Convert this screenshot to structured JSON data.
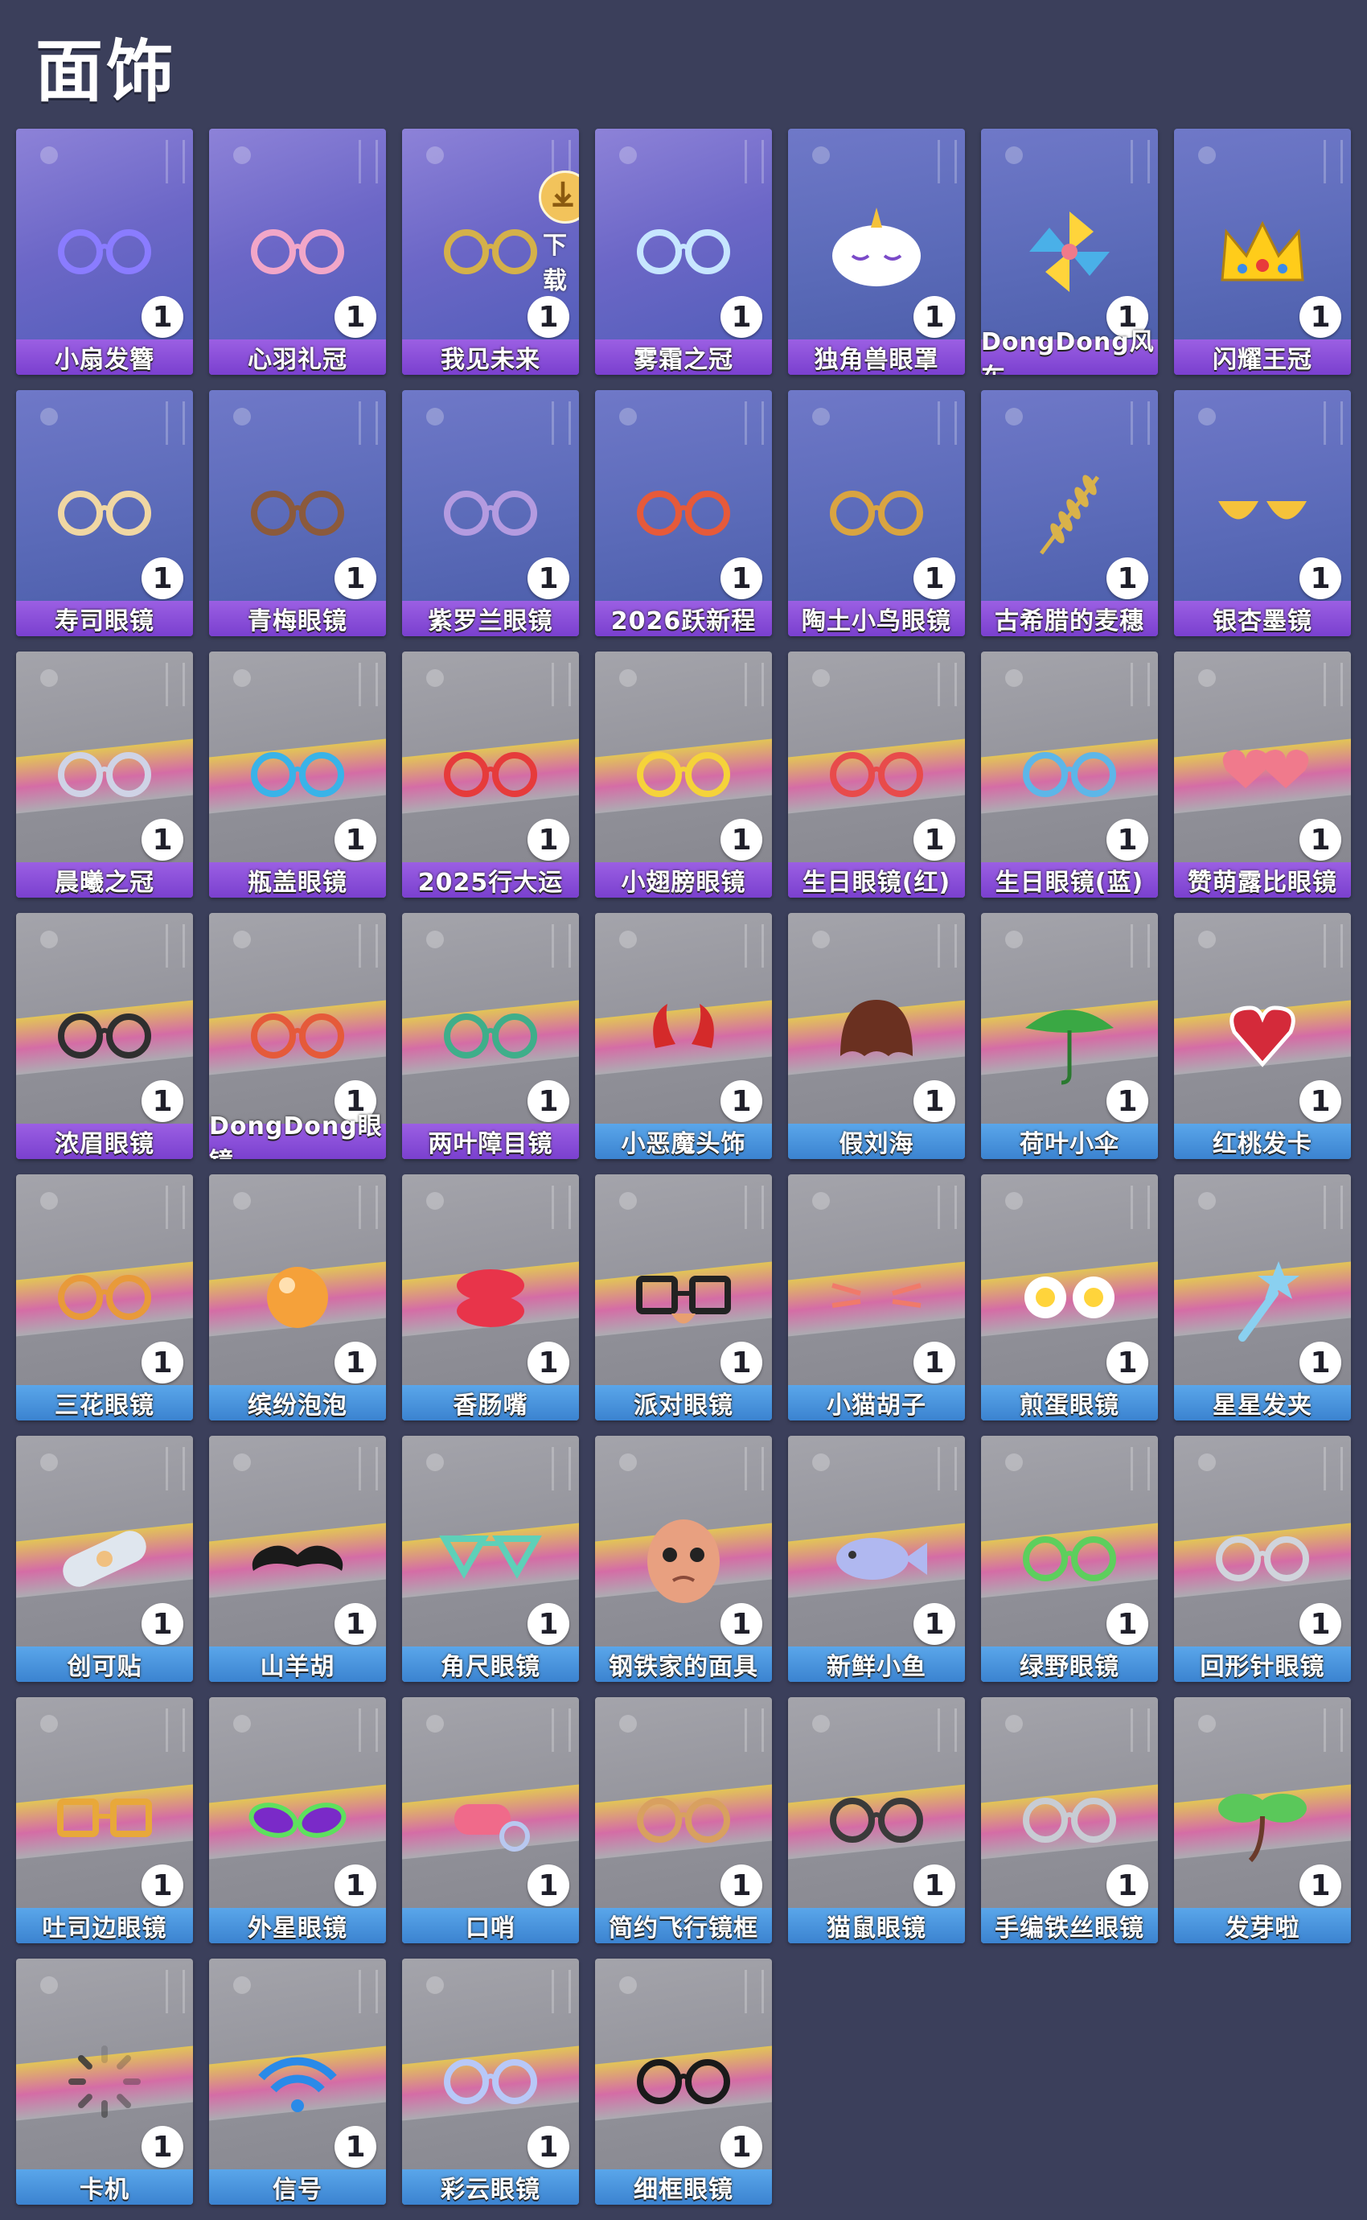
{
  "page": {
    "title": "面饰"
  },
  "download_text": "下载",
  "items": [
    {
      "name": "小扇发簪",
      "qty": "1",
      "rarity": "purple",
      "icon": "fan-hairpin-icon",
      "color": "#8a7cff"
    },
    {
      "name": "心羽礼冠",
      "qty": "1",
      "rarity": "purple",
      "icon": "feather-crown-icon",
      "color": "#f2a6c8"
    },
    {
      "name": "我见未来",
      "qty": "1",
      "rarity": "purple",
      "icon": "future-glasses-icon",
      "color": "#d4b14a"
    },
    {
      "name": "雾霜之冠",
      "qty": "1",
      "rarity": "purple",
      "icon": "frost-crown-icon",
      "color": "#c7e6ff"
    },
    {
      "name": "独角兽眼罩",
      "qty": "1",
      "rarity": "purple",
      "icon": "unicorn-mask-icon",
      "color": "#ffffff"
    },
    {
      "name": "DongDong风车",
      "qty": "1",
      "rarity": "purple",
      "icon": "pinwheel-icon",
      "color": "#ffd43b"
    },
    {
      "name": "闪耀王冠",
      "qty": "1",
      "rarity": "purple",
      "icon": "crown-icon",
      "color": "#ffcc1a"
    },
    {
      "name": "寿司眼镜",
      "qty": "1",
      "rarity": "purple",
      "icon": "sushi-glasses-icon",
      "color": "#f0d7a3"
    },
    {
      "name": "青梅眼镜",
      "qty": "1",
      "rarity": "purple",
      "icon": "plum-glasses-icon",
      "color": "#8b5a3c"
    },
    {
      "name": "紫罗兰眼镜",
      "qty": "1",
      "rarity": "purple",
      "icon": "violet-glasses-icon",
      "color": "#b49be0"
    },
    {
      "name": "2026跃新程",
      "qty": "1",
      "rarity": "purple",
      "icon": "2026-glasses-icon",
      "color": "#e65a3a"
    },
    {
      "name": "陶土小鸟眼镜",
      "qty": "1",
      "rarity": "purple",
      "icon": "clay-bird-glasses-icon",
      "color": "#d9a441"
    },
    {
      "name": "古希腊的麦穗",
      "qty": "1",
      "rarity": "purple",
      "icon": "wheat-icon",
      "color": "#d9b24a"
    },
    {
      "name": "银杏墨镜",
      "qty": "1",
      "rarity": "purple",
      "icon": "ginkgo-sunglasses-icon",
      "color": "#f5c23b"
    },
    {
      "name": "晨曦之冠",
      "qty": "1",
      "rarity": "purple",
      "icon": "dawn-crown-icon",
      "color": "#cfd3e6"
    },
    {
      "name": "瓶盖眼镜",
      "qty": "1",
      "rarity": "purple",
      "icon": "bottlecap-glasses-icon",
      "color": "#39b3e8"
    },
    {
      "name": "2025行大运",
      "qty": "1",
      "rarity": "purple",
      "icon": "2025-glasses-icon",
      "color": "#e63b3b"
    },
    {
      "name": "小翅膀眼镜",
      "qty": "1",
      "rarity": "purple",
      "icon": "wing-glasses-icon",
      "color": "#f5d33a"
    },
    {
      "name": "生日眼镜(红)",
      "qty": "1",
      "rarity": "purple",
      "icon": "birthday-glasses-red-icon",
      "color": "#e84b4b"
    },
    {
      "name": "生日眼镜(蓝)",
      "qty": "1",
      "rarity": "purple",
      "icon": "birthday-glasses-blue-icon",
      "color": "#5db6e8"
    },
    {
      "name": "赞萌露比眼镜",
      "qty": "1",
      "rarity": "purple",
      "icon": "heart-glasses-icon",
      "color": "#f07a8c"
    },
    {
      "name": "浓眉眼镜",
      "qty": "1",
      "rarity": "purple",
      "icon": "eyebrow-glasses-icon",
      "color": "#2f2f2f"
    },
    {
      "name": "DongDong眼镜",
      "qty": "1",
      "rarity": "purple",
      "icon": "round-glasses-icon",
      "color": "#e55a3a"
    },
    {
      "name": "两叶障目镜",
      "qty": "1",
      "rarity": "purple",
      "icon": "leaf-glasses-icon",
      "color": "#3fae8a"
    },
    {
      "name": "小恶魔头饰",
      "qty": "1",
      "rarity": "blue",
      "icon": "devil-horns-icon",
      "color": "#d42a2a"
    },
    {
      "name": "假刘海",
      "qty": "1",
      "rarity": "blue",
      "icon": "bangs-icon",
      "color": "#6a3020"
    },
    {
      "name": "荷叶小伞",
      "qty": "1",
      "rarity": "blue",
      "icon": "lotus-umbrella-icon",
      "color": "#3aa844"
    },
    {
      "name": "红桃发卡",
      "qty": "1",
      "rarity": "blue",
      "icon": "heart-hairclip-icon",
      "color": "#d42a3a"
    },
    {
      "name": "三花眼镜",
      "qty": "1",
      "rarity": "blue",
      "icon": "calico-glasses-icon",
      "color": "#e89a3a"
    },
    {
      "name": "缤纷泡泡",
      "qty": "1",
      "rarity": "blue",
      "icon": "bubble-icon",
      "color": "#f5a13a"
    },
    {
      "name": "香肠嘴",
      "qty": "1",
      "rarity": "blue",
      "icon": "sausage-lips-icon",
      "color": "#e8344a"
    },
    {
      "name": "派对眼镜",
      "qty": "1",
      "rarity": "blue",
      "icon": "party-glasses-icon",
      "color": "#222222"
    },
    {
      "name": "小猫胡子",
      "qty": "1",
      "rarity": "blue",
      "icon": "cat-whiskers-icon",
      "color": "#f07a6a"
    },
    {
      "name": "煎蛋眼镜",
      "qty": "1",
      "rarity": "blue",
      "icon": "egg-glasses-icon",
      "color": "#ffd43b"
    },
    {
      "name": "星星发夹",
      "qty": "1",
      "rarity": "blue",
      "icon": "star-hairclip-icon",
      "color": "#8ad0f0"
    },
    {
      "name": "创可贴",
      "qty": "1",
      "rarity": "blue",
      "icon": "bandaid-icon",
      "color": "#dfe6ee"
    },
    {
      "name": "山羊胡",
      "qty": "1",
      "rarity": "blue",
      "icon": "mustache-icon",
      "color": "#1a1a1a"
    },
    {
      "name": "角尺眼镜",
      "qty": "1",
      "rarity": "blue",
      "icon": "triangle-glasses-icon",
      "color": "#5ed0b8"
    },
    {
      "name": "钢铁家的面具",
      "qty": "1",
      "rarity": "blue",
      "icon": "face-mask-icon",
      "color": "#e8a080"
    },
    {
      "name": "新鲜小鱼",
      "qty": "1",
      "rarity": "blue",
      "icon": "fish-icon",
      "color": "#b0b8f0"
    },
    {
      "name": "绿野眼镜",
      "qty": "1",
      "rarity": "blue",
      "icon": "green-glasses-icon",
      "color": "#5dcf5d"
    },
    {
      "name": "回形针眼镜",
      "qty": "1",
      "rarity": "blue",
      "icon": "paperclip-glasses-icon",
      "color": "#d0d4dc"
    },
    {
      "name": "吐司边眼镜",
      "qty": "1",
      "rarity": "blue",
      "icon": "toast-glasses-icon",
      "color": "#e8a83a"
    },
    {
      "name": "外星眼镜",
      "qty": "1",
      "rarity": "blue",
      "icon": "alien-glasses-icon",
      "color": "#7a2ac8"
    },
    {
      "name": "口哨",
      "qty": "1",
      "rarity": "blue",
      "icon": "whistle-icon",
      "color": "#f06a8a"
    },
    {
      "name": "简约飞行镜框",
      "qty": "1",
      "rarity": "blue",
      "icon": "aviator-glasses-icon",
      "color": "#d8a060"
    },
    {
      "name": "猫鼠眼镜",
      "qty": "1",
      "rarity": "blue",
      "icon": "cat-mouse-glasses-icon",
      "color": "#3a3a3a"
    },
    {
      "name": "手编铁丝眼镜",
      "qty": "1",
      "rarity": "blue",
      "icon": "wire-glasses-icon",
      "color": "#c8ccd4"
    },
    {
      "name": "发芽啦",
      "qty": "1",
      "rarity": "blue",
      "icon": "sprout-icon",
      "color": "#5ac85a"
    },
    {
      "name": "卡机",
      "qty": "1",
      "rarity": "blue",
      "icon": "loading-spinner-icon",
      "color": "#3a3a3a"
    },
    {
      "name": "信号",
      "qty": "1",
      "rarity": "blue",
      "icon": "wifi-signal-icon",
      "color": "#2a8ae8"
    },
    {
      "name": "彩云眼镜",
      "qty": "1",
      "rarity": "blue",
      "icon": "cloud-glasses-icon",
      "color": "#b8c8f8"
    },
    {
      "name": "细框眼镜",
      "qty": "1",
      "rarity": "blue",
      "icon": "thin-glasses-icon",
      "color": "#1a1a1a"
    }
  ]
}
